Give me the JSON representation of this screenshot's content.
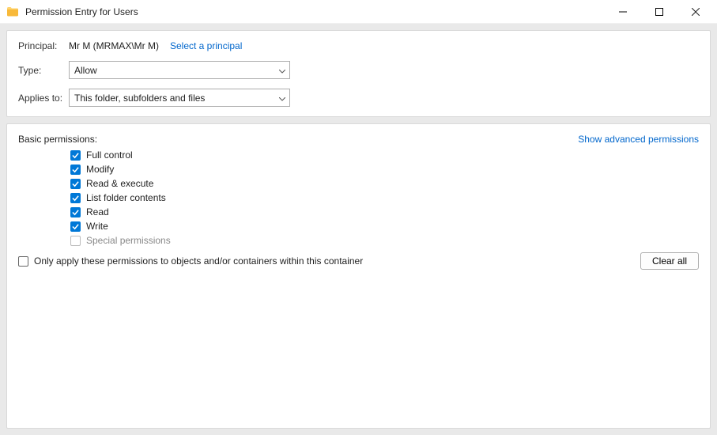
{
  "titlebar": {
    "title": "Permission Entry for Users"
  },
  "principal": {
    "label": "Principal:",
    "value": "Mr M (MRMAX\\Mr M)",
    "select_link": "Select a principal"
  },
  "type": {
    "label": "Type:",
    "selected": "Allow"
  },
  "applies_to": {
    "label": "Applies to:",
    "selected": "This folder, subfolders and files"
  },
  "permissions": {
    "header": "Basic permissions:",
    "advanced_link": "Show advanced permissions",
    "items": [
      {
        "label": "Full control",
        "checked": true,
        "disabled": false
      },
      {
        "label": "Modify",
        "checked": true,
        "disabled": false
      },
      {
        "label": "Read & execute",
        "checked": true,
        "disabled": false
      },
      {
        "label": "List folder contents",
        "checked": true,
        "disabled": false
      },
      {
        "label": "Read",
        "checked": true,
        "disabled": false
      },
      {
        "label": "Write",
        "checked": true,
        "disabled": false
      },
      {
        "label": "Special permissions",
        "checked": false,
        "disabled": true
      }
    ]
  },
  "only_apply": {
    "checked": false,
    "label": "Only apply these permissions to objects and/or containers within this container"
  },
  "clear_all": "Clear all"
}
